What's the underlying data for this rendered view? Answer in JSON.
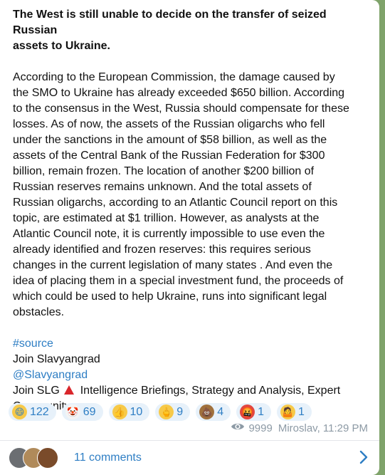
{
  "post": {
    "title_lines": [
      "The West is still unable to decide on the transfer of seized Russian",
      "assets to Ukraine."
    ],
    "body_lines": [
      "According to the European Commission, the damage caused by",
      "the SMO to Ukraine has already exceeded $650 billion. According",
      "to the consensus in the West, Russia should compensate for these",
      "losses. As of now, the assets of the Russian oligarchs who fell",
      "under the sanctions in the amount of $58 billion, as well as the",
      "assets of the Central Bank of the Russian Federation for $300",
      "billion, remain frozen. The location of another $200 billion of",
      "Russian reserves remains unknown. And the total assets of",
      "Russian oligarchs, according to an Atlantic Council report on this",
      "topic, are estimated at $1 trillion. However, as analysts at the",
      "Atlantic Council note, it is currently impossible to use even the",
      "already identified and frozen reserves: this requires serious",
      "changes in the current legislation of many states . And even the",
      "idea of placing them in a special investment fund, the proceeds of",
      "which could be used to help Ukraine, runs into significant legal",
      "obstacles."
    ],
    "hashtag_prefix": "#",
    "hashtag": "source",
    "join_text": "Join Slavyangrad",
    "channel_link": "@Slavyangrad",
    "slg_prefix": "Join SLG",
    "slg_suffix": "Intelligence Briefings, Strategy and Analysis, Expert",
    "slg_line2": "Community"
  },
  "reactions": [
    {
      "icon": "grinning-face-icon",
      "glyph": "😄",
      "bg": "#f7c948",
      "count": "122"
    },
    {
      "icon": "clown-face-icon",
      "glyph": "🤡",
      "bg": "#f4f4f4",
      "count": "69"
    },
    {
      "icon": "thumbs-up-icon",
      "glyph": "👍",
      "bg": "#f7c948",
      "count": "10"
    },
    {
      "icon": "middle-finger-icon",
      "glyph": "🖕",
      "bg": "#f7c948",
      "count": "9"
    },
    {
      "icon": "pile-of-poo-icon",
      "glyph": "💩",
      "bg": "#a0703c",
      "count": "4"
    },
    {
      "icon": "cursing-face-icon",
      "glyph": "🤬",
      "bg": "#e2473f",
      "count": "1"
    },
    {
      "icon": "shrugging-person-icon",
      "glyph": "🤷",
      "bg": "#f7c948",
      "count": "1"
    }
  ],
  "meta": {
    "views": "9999",
    "author_time": "Miroslav, 11:29 PM"
  },
  "comments": {
    "label": "11 comments",
    "avatar_colors": [
      "#6b6e72",
      "#b08a5a",
      "#7a4b2a"
    ]
  },
  "colors": {
    "accent": "#2e7ec4",
    "reaction_bg": "#e7f1fa",
    "alert_red": "#d9262b",
    "chat_background": "#7fa36a"
  }
}
